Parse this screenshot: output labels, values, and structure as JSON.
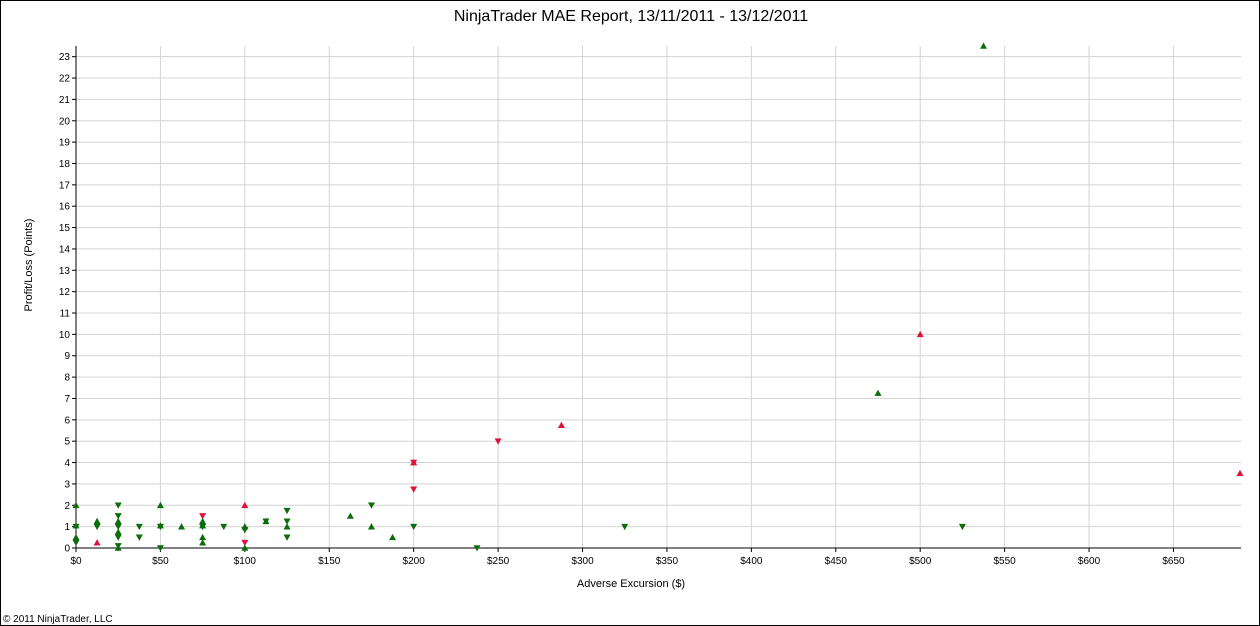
{
  "footer": "© 2011 NinjaTrader, LLC",
  "colors": {
    "winner": "#0a6e0a",
    "loser": "#dc143c",
    "grid": "#d3d3d3"
  },
  "chart_data": {
    "type": "scatter",
    "title": "NinjaTrader MAE Report, 13/11/2011 - 13/12/2011",
    "xlabel": "Adverse Excursion ($)",
    "ylabel": "Profit/Loss (Points)",
    "xlim": [
      0,
      690
    ],
    "ylim": [
      0,
      23.5
    ],
    "x_ticks": [
      0,
      50,
      100,
      150,
      200,
      250,
      300,
      350,
      400,
      450,
      500,
      550,
      600,
      650
    ],
    "x_tick_labels": [
      "$0",
      "$50",
      "$100",
      "$150",
      "$200",
      "$250",
      "$300",
      "$350",
      "$400",
      "$450",
      "$500",
      "$550",
      "$600",
      "$650"
    ],
    "y_ticks": [
      0,
      1,
      2,
      3,
      4,
      5,
      6,
      7,
      8,
      9,
      10,
      11,
      12,
      13,
      14,
      15,
      16,
      17,
      18,
      19,
      20,
      21,
      22,
      23
    ],
    "grid": true,
    "legend": "none",
    "marker_note": "up triangle = long trade, down triangle = short trade; green = winner, red = loser",
    "points": [
      {
        "x": 0,
        "y": 2.0,
        "dir": "long",
        "color": "green"
      },
      {
        "x": 0,
        "y": 1.0,
        "dir": "short",
        "color": "green"
      },
      {
        "x": 0,
        "y": 0.5,
        "dir": "long",
        "color": "green"
      },
      {
        "x": 0,
        "y": 0.25,
        "dir": "short",
        "color": "green"
      },
      {
        "x": 0,
        "y": 1.05,
        "dir": "long",
        "color": "green"
      },
      {
        "x": 12.5,
        "y": 1.25,
        "dir": "long",
        "color": "green"
      },
      {
        "x": 12.5,
        "y": 1.0,
        "dir": "short",
        "color": "green"
      },
      {
        "x": 12.5,
        "y": 0.25,
        "dir": "long",
        "color": "red"
      },
      {
        "x": 25,
        "y": 2.0,
        "dir": "short",
        "color": "green"
      },
      {
        "x": 25,
        "y": 1.5,
        "dir": "short",
        "color": "green"
      },
      {
        "x": 25,
        "y": 1.25,
        "dir": "long",
        "color": "green"
      },
      {
        "x": 25,
        "y": 1.0,
        "dir": "short",
        "color": "green"
      },
      {
        "x": 25,
        "y": 0.75,
        "dir": "long",
        "color": "green"
      },
      {
        "x": 25,
        "y": 0.5,
        "dir": "short",
        "color": "green"
      },
      {
        "x": 25,
        "y": 0.1,
        "dir": "short",
        "color": "green"
      },
      {
        "x": 25,
        "y": 0.0,
        "dir": "long",
        "color": "green"
      },
      {
        "x": 37.5,
        "y": 1.0,
        "dir": "short",
        "color": "green"
      },
      {
        "x": 37.5,
        "y": 0.5,
        "dir": "short",
        "color": "green"
      },
      {
        "x": 50,
        "y": 2.0,
        "dir": "long",
        "color": "green"
      },
      {
        "x": 50,
        "y": 1.0,
        "dir": "short",
        "color": "green"
      },
      {
        "x": 50,
        "y": 1.05,
        "dir": "long",
        "color": "green"
      },
      {
        "x": 50,
        "y": 0.0,
        "dir": "short",
        "color": "green"
      },
      {
        "x": 62.5,
        "y": 1.0,
        "dir": "long",
        "color": "green"
      },
      {
        "x": 75,
        "y": 1.5,
        "dir": "short",
        "color": "red"
      },
      {
        "x": 75,
        "y": 1.25,
        "dir": "long",
        "color": "green"
      },
      {
        "x": 75,
        "y": 1.0,
        "dir": "short",
        "color": "green"
      },
      {
        "x": 75,
        "y": 1.05,
        "dir": "long",
        "color": "green"
      },
      {
        "x": 75,
        "y": 0.5,
        "dir": "long",
        "color": "green"
      },
      {
        "x": 75,
        "y": 0.25,
        "dir": "long",
        "color": "green"
      },
      {
        "x": 87.5,
        "y": 1.0,
        "dir": "short",
        "color": "green"
      },
      {
        "x": 100,
        "y": 2.0,
        "dir": "long",
        "color": "red"
      },
      {
        "x": 100,
        "y": 1.0,
        "dir": "long",
        "color": "green"
      },
      {
        "x": 100,
        "y": 0.85,
        "dir": "short",
        "color": "green"
      },
      {
        "x": 100,
        "y": 0.25,
        "dir": "short",
        "color": "red"
      },
      {
        "x": 100,
        "y": 0.0,
        "dir": "long",
        "color": "green"
      },
      {
        "x": 112.5,
        "y": 1.25,
        "dir": "long",
        "color": "green"
      },
      {
        "x": 112.5,
        "y": 1.25,
        "dir": "short",
        "color": "green"
      },
      {
        "x": 125,
        "y": 1.75,
        "dir": "short",
        "color": "green"
      },
      {
        "x": 125,
        "y": 1.25,
        "dir": "short",
        "color": "green"
      },
      {
        "x": 125,
        "y": 1.0,
        "dir": "long",
        "color": "green"
      },
      {
        "x": 125,
        "y": 0.5,
        "dir": "short",
        "color": "green"
      },
      {
        "x": 162.5,
        "y": 1.5,
        "dir": "long",
        "color": "green"
      },
      {
        "x": 175,
        "y": 2.0,
        "dir": "short",
        "color": "green"
      },
      {
        "x": 175,
        "y": 1.0,
        "dir": "long",
        "color": "green"
      },
      {
        "x": 187.5,
        "y": 0.5,
        "dir": "long",
        "color": "green"
      },
      {
        "x": 200,
        "y": 4.0,
        "dir": "long",
        "color": "red"
      },
      {
        "x": 200,
        "y": 4.0,
        "dir": "short",
        "color": "red"
      },
      {
        "x": 200,
        "y": 2.75,
        "dir": "short",
        "color": "red"
      },
      {
        "x": 200,
        "y": 1.0,
        "dir": "short",
        "color": "green"
      },
      {
        "x": 237.5,
        "y": 0.0,
        "dir": "short",
        "color": "green"
      },
      {
        "x": 250,
        "y": 5.0,
        "dir": "short",
        "color": "red"
      },
      {
        "x": 287.5,
        "y": 5.75,
        "dir": "long",
        "color": "red"
      },
      {
        "x": 325,
        "y": 1.0,
        "dir": "short",
        "color": "green"
      },
      {
        "x": 475,
        "y": 7.25,
        "dir": "long",
        "color": "green"
      },
      {
        "x": 500,
        "y": 10.0,
        "dir": "long",
        "color": "red"
      },
      {
        "x": 525,
        "y": 1.0,
        "dir": "short",
        "color": "green"
      },
      {
        "x": 537.5,
        "y": 23.5,
        "dir": "long",
        "color": "green"
      },
      {
        "x": 690,
        "y": 3.5,
        "dir": "long",
        "color": "red"
      }
    ]
  }
}
